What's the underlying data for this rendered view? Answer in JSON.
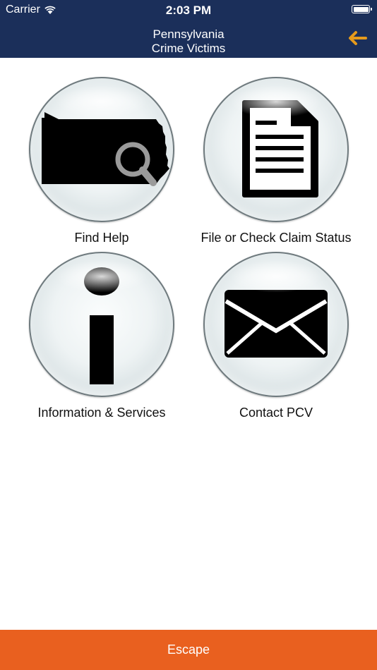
{
  "status_bar": {
    "carrier": "Carrier",
    "time": "2:03 PM"
  },
  "header": {
    "title_line1": "Pennsylvania",
    "title_line2": "Crime Victims"
  },
  "tiles": [
    {
      "label": "Find Help"
    },
    {
      "label": "File or Check Claim Status"
    },
    {
      "label": "Information & Services"
    },
    {
      "label": "Contact PCV"
    }
  ],
  "escape": {
    "label": "Escape"
  },
  "colors": {
    "header": "#1b2f5a",
    "back_arrow": "#e59a1c",
    "escape": "#e9601f"
  }
}
